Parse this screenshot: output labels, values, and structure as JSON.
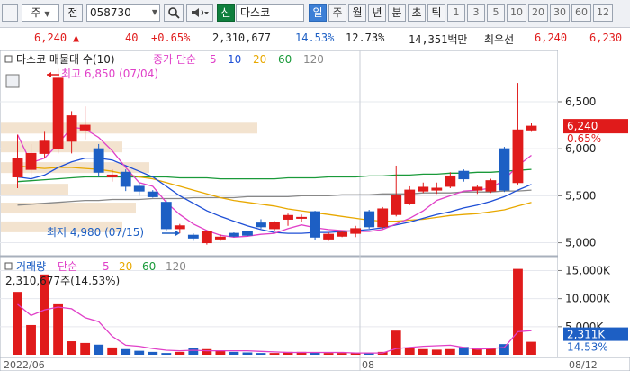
{
  "toolbar": {
    "menu_box": "",
    "type_label": "주",
    "prev_label": "전",
    "code": "058730",
    "search_icon": "search-icon",
    "speaker_icon": "speaker-icon",
    "new_label": "신",
    "name": "다스코",
    "periods": [
      "일",
      "주",
      "월",
      "년",
      "분",
      "초",
      "틱"
    ],
    "selected_period": "일",
    "intervals": [
      "1",
      "3",
      "5",
      "10",
      "20",
      "30",
      "60",
      "12"
    ]
  },
  "quote": {
    "price": "6,240",
    "change_icon": "up-triangle-icon",
    "change": "40",
    "change_rate": "+0.65%",
    "volume": "2,310,677",
    "volume_ratio": "14.53%",
    "turnover": "12.73%",
    "amount": "14,351백만",
    "preferred_label": "최우선",
    "ask": "6,240",
    "bid": "6,230"
  },
  "price_panel": {
    "legend_name": "다스코 매물대 수(10)",
    "legend_ma": "종가 단순",
    "ma_periods": [
      "5",
      "10",
      "20",
      "60",
      "120"
    ],
    "ma_colors": [
      "#e040c8",
      "#1e4fd6",
      "#e8a800",
      "#1a9a3a",
      "#888888"
    ],
    "high_note": "최고 6,850 (07/04)",
    "low_note": "최저 4,980 (07/15)",
    "axis_labels": [
      "6,500",
      "6,000",
      "5,500",
      "5,000"
    ],
    "current_price_tag": "6,240",
    "current_rate_tag": "0.65%"
  },
  "volume_panel": {
    "legend_name": "거래량",
    "legend_ma": "단순",
    "ma_periods": [
      "5",
      "20",
      "60",
      "120"
    ],
    "ma_colors": [
      "#e040c8",
      "#e8a800",
      "#1a9a3a",
      "#888888"
    ],
    "value_note": "2,310,677주(14.53%)",
    "axis_labels": [
      "15,000K",
      "10,000K",
      "5,000K"
    ],
    "current_volume_tag": "2,311K",
    "current_rate_tag": "14.53%"
  },
  "x_labels": [
    "2022/06",
    "08",
    "08/12"
  ],
  "colors": {
    "up": "#e01b1b",
    "down": "#1d5fc4",
    "volume_profile": "#f3e3cf"
  },
  "chart_data": {
    "type": "candlestick",
    "candles": [
      {
        "o": 5700,
        "h": 6150,
        "l": 5580,
        "c": 5900
      },
      {
        "o": 5780,
        "h": 6050,
        "l": 5650,
        "c": 5950
      },
      {
        "o": 5950,
        "h": 6180,
        "l": 5900,
        "c": 6080
      },
      {
        "o": 6000,
        "h": 6850,
        "l": 5950,
        "c": 6750
      },
      {
        "o": 6080,
        "h": 6400,
        "l": 5950,
        "c": 6350
      },
      {
        "o": 6200,
        "h": 6450,
        "l": 6100,
        "c": 6250
      },
      {
        "o": 6000,
        "h": 6050,
        "l": 5700,
        "c": 5750
      },
      {
        "o": 5700,
        "h": 5780,
        "l": 5650,
        "c": 5720
      },
      {
        "o": 5750,
        "h": 5780,
        "l": 5550,
        "c": 5600
      },
      {
        "o": 5600,
        "h": 5640,
        "l": 5500,
        "c": 5550
      },
      {
        "o": 5540,
        "h": 5560,
        "l": 5480,
        "c": 5490
      },
      {
        "o": 5430,
        "h": 5450,
        "l": 5130,
        "c": 5150
      },
      {
        "o": 5150,
        "h": 5200,
        "l": 5100,
        "c": 5180
      },
      {
        "o": 5080,
        "h": 5100,
        "l": 5020,
        "c": 5050
      },
      {
        "o": 5000,
        "h": 5130,
        "l": 4980,
        "c": 5120
      },
      {
        "o": 5040,
        "h": 5090,
        "l": 5020,
        "c": 5060
      },
      {
        "o": 5100,
        "h": 5110,
        "l": 5060,
        "c": 5070
      },
      {
        "o": 5120,
        "h": 5130,
        "l": 5070,
        "c": 5080
      },
      {
        "o": 5210,
        "h": 5250,
        "l": 5150,
        "c": 5170
      },
      {
        "o": 5150,
        "h": 5230,
        "l": 5120,
        "c": 5220
      },
      {
        "o": 5250,
        "h": 5310,
        "l": 5180,
        "c": 5290
      },
      {
        "o": 5260,
        "h": 5300,
        "l": 5220,
        "c": 5270
      },
      {
        "o": 5330,
        "h": 5340,
        "l": 5030,
        "c": 5060
      },
      {
        "o": 5040,
        "h": 5110,
        "l": 5020,
        "c": 5090
      },
      {
        "o": 5070,
        "h": 5130,
        "l": 5060,
        "c": 5110
      },
      {
        "o": 5100,
        "h": 5180,
        "l": 5060,
        "c": 5150
      },
      {
        "o": 5330,
        "h": 5350,
        "l": 5150,
        "c": 5170
      },
      {
        "o": 5170,
        "h": 5380,
        "l": 5150,
        "c": 5360
      },
      {
        "o": 5300,
        "h": 5820,
        "l": 5280,
        "c": 5500
      },
      {
        "o": 5420,
        "h": 5600,
        "l": 5400,
        "c": 5560
      },
      {
        "o": 5550,
        "h": 5640,
        "l": 5530,
        "c": 5590
      },
      {
        "o": 5560,
        "h": 5640,
        "l": 5520,
        "c": 5580
      },
      {
        "o": 5600,
        "h": 5750,
        "l": 5580,
        "c": 5710
      },
      {
        "o": 5760,
        "h": 5780,
        "l": 5650,
        "c": 5680
      },
      {
        "o": 5560,
        "h": 5610,
        "l": 5520,
        "c": 5590
      },
      {
        "o": 5550,
        "h": 5680,
        "l": 5530,
        "c": 5660
      },
      {
        "o": 6000,
        "h": 6020,
        "l": 5540,
        "c": 5560
      },
      {
        "o": 5640,
        "h": 6700,
        "l": 5620,
        "c": 6200
      },
      {
        "o": 6200,
        "h": 6270,
        "l": 6180,
        "c": 6240
      }
    ],
    "volumes_k": [
      11200,
      5300,
      14300,
      9000,
      2400,
      2100,
      1800,
      1300,
      1000,
      700,
      500,
      300,
      500,
      1200,
      1000,
      700,
      500,
      400,
      300,
      300,
      500,
      500,
      400,
      300,
      300,
      300,
      300,
      500,
      4300,
      1200,
      1000,
      900,
      1000,
      1400,
      1100,
      1100,
      1900,
      15300,
      2310
    ],
    "ma5": [
      6150,
      5850,
      5900,
      6050,
      6230,
      6210,
      6120,
      5980,
      5800,
      5640,
      5600,
      5430,
      5300,
      5200,
      5130,
      5080,
      5060,
      5070,
      5090,
      5100,
      5150,
      5190,
      5160,
      5140,
      5130,
      5120,
      5120,
      5140,
      5200,
      5260,
      5340,
      5450,
      5500,
      5550,
      5560,
      5580,
      5670,
      5820,
      5930
    ],
    "ma10": [
      5700,
      5680,
      5720,
      5800,
      5860,
      5900,
      5900,
      5880,
      5820,
      5760,
      5700,
      5600,
      5500,
      5420,
      5340,
      5280,
      5230,
      5180,
      5140,
      5110,
      5100,
      5100,
      5110,
      5110,
      5120,
      5130,
      5140,
      5160,
      5190,
      5220,
      5260,
      5300,
      5330,
      5370,
      5400,
      5440,
      5490,
      5560,
      5620
    ],
    "ma20": [
      5820,
      5800,
      5790,
      5800,
      5800,
      5790,
      5780,
      5760,
      5730,
      5700,
      5680,
      5640,
      5600,
      5560,
      5520,
      5480,
      5450,
      5430,
      5410,
      5390,
      5360,
      5340,
      5320,
      5300,
      5280,
      5260,
      5240,
      5230,
      5230,
      5240,
      5250,
      5270,
      5290,
      5300,
      5310,
      5330,
      5350,
      5390,
      5430
    ],
    "ma60": [
      5650,
      5660,
      5670,
      5680,
      5690,
      5700,
      5700,
      5700,
      5700,
      5700,
      5700,
      5700,
      5690,
      5690,
      5690,
      5680,
      5680,
      5680,
      5680,
      5680,
      5690,
      5690,
      5690,
      5700,
      5700,
      5700,
      5710,
      5710,
      5720,
      5720,
      5730,
      5730,
      5740,
      5740,
      5750,
      5750,
      5760,
      5770,
      5780
    ],
    "ma120": [
      5400,
      5410,
      5420,
      5430,
      5440,
      5450,
      5450,
      5460,
      5460,
      5460,
      5470,
      5470,
      5470,
      5480,
      5480,
      5480,
      5480,
      5490,
      5490,
      5490,
      5490,
      5500,
      5500,
      5500,
      5510,
      5510,
      5510,
      5520,
      5520,
      5520,
      5530,
      5530,
      5530,
      5540,
      5540,
      5540,
      5550,
      5550,
      5560
    ],
    "vol_ma5": [
      9000,
      7000,
      8000,
      8500,
      8200,
      6600,
      5900,
      3300,
      1700,
      1500,
      1100,
      800,
      700,
      800,
      700,
      700,
      700,
      700,
      600,
      500,
      400,
      400,
      400,
      400,
      400,
      300,
      300,
      300,
      1100,
      1300,
      1500,
      1600,
      1700,
      1300,
      1000,
      1100,
      1300,
      4100,
      4300
    ],
    "volume_profile": [
      {
        "price": 6200,
        "rel": 0.95
      },
      {
        "price": 6000,
        "rel": 0.45
      },
      {
        "price": 5780,
        "rel": 0.55
      },
      {
        "price": 5550,
        "rel": 0.25
      },
      {
        "price": 5350,
        "rel": 0.5
      },
      {
        "price": 5150,
        "rel": 0.45
      }
    ],
    "ylim": [
      4900,
      6950
    ],
    "volume_ylim_k": [
      0,
      17000
    ]
  }
}
